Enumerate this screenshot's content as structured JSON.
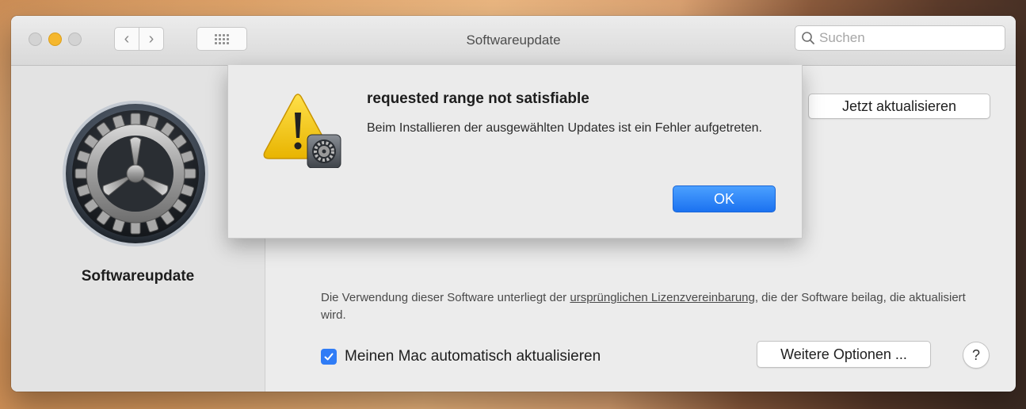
{
  "window": {
    "title": "Softwareupdate",
    "search_placeholder": "Suchen"
  },
  "toolbar": {
    "back_symbol": "‹",
    "forward_symbol": "›"
  },
  "sidebar": {
    "title": "Softwareupdate",
    "icon": "gear-icon"
  },
  "main": {
    "update_button": "Jetzt aktualisieren",
    "license_prefix": "Die Verwendung dieser Software unterliegt der ",
    "license_link": "ursprünglichen Lizenzvereinbarung",
    "license_suffix": ", die der Software beilag, die aktualisiert wird.",
    "auto_update_label": "Meinen Mac automatisch aktualisieren",
    "auto_update_checked": true,
    "more_options_button": "Weitere Optionen ...",
    "help_button": "?"
  },
  "alert": {
    "title": "requested range not satisfiable",
    "message": "Beim Installieren der ausgewählten Updates ist ein Fehler aufgetreten.",
    "ok_button": "OK",
    "icon": "warning-icon"
  },
  "colors": {
    "accent": "#2f7cf6",
    "warning_yellow": "#f5c400"
  }
}
